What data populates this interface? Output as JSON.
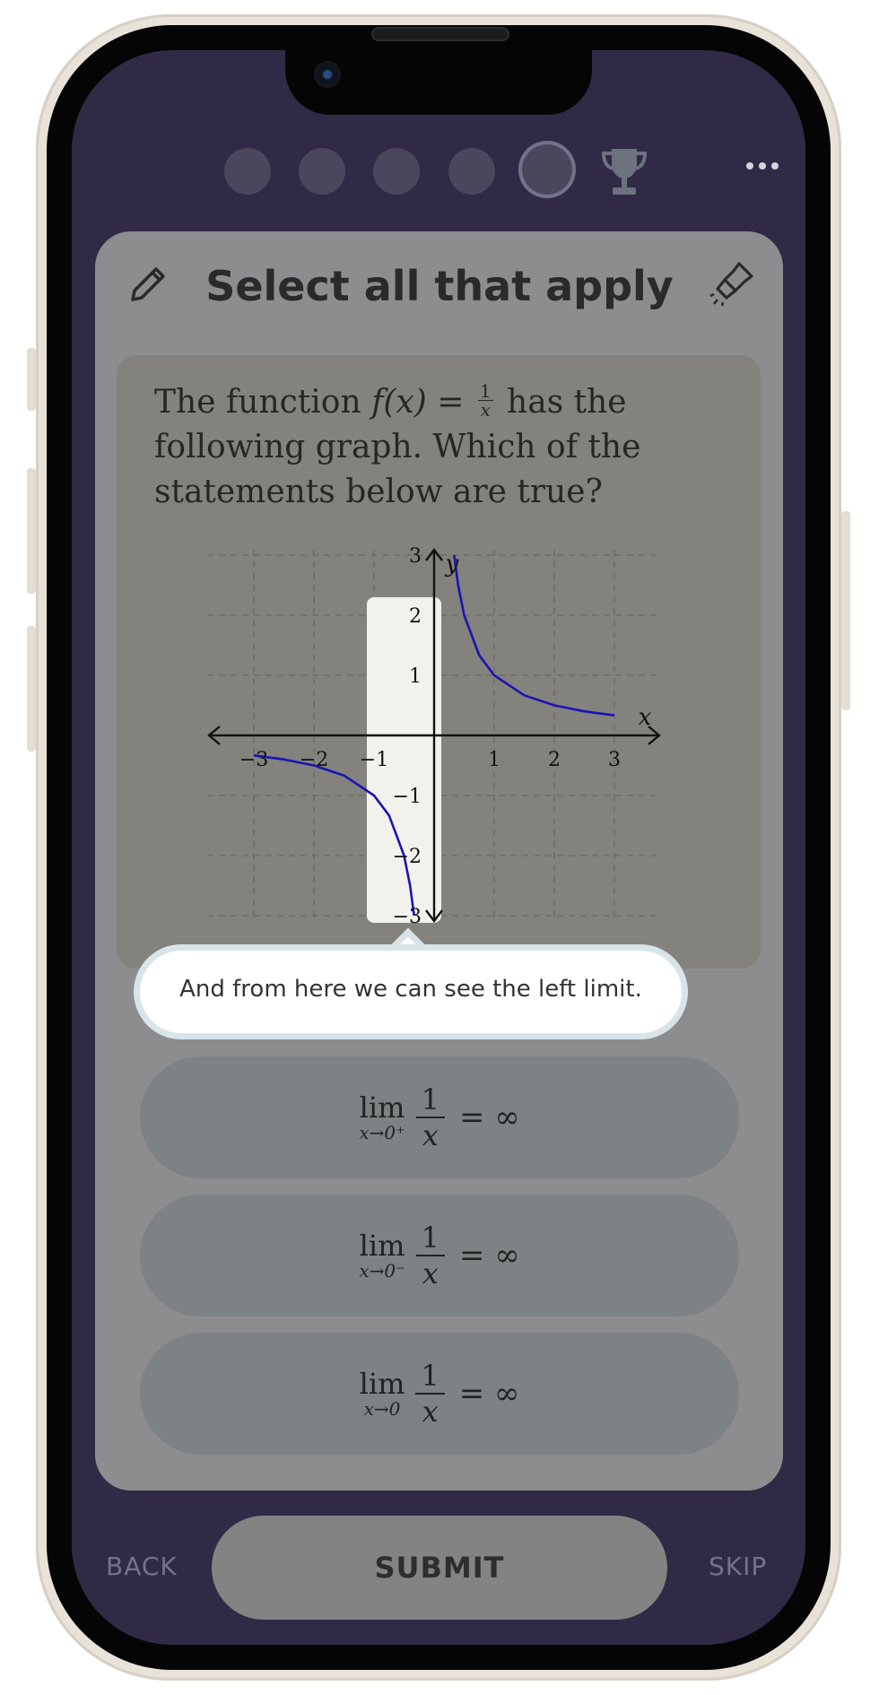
{
  "header": {
    "progress_total": 5,
    "progress_current": 5,
    "trophy_icon": "trophy-icon",
    "more_icon": "more-horizontal-icon"
  },
  "card": {
    "title": "Select all that apply",
    "left_icon": "pencil-icon",
    "right_icon": "flashlight-icon"
  },
  "question": {
    "text_before": "The function ",
    "func": "f(x) = ",
    "frac_num": "1",
    "frac_den": "x",
    "text_after": " has the following graph. Which of the statements below are true?"
  },
  "chart_data": {
    "type": "line",
    "function": "y = 1/x",
    "xlabel": "x",
    "ylabel": "y",
    "xlim": [
      -3,
      3
    ],
    "ylim": [
      -3,
      3
    ],
    "x_ticks": [
      "−3",
      "−2",
      "−1",
      "1",
      "2",
      "3"
    ],
    "y_ticks": [
      "3",
      "2",
      "1",
      "−1",
      "−2",
      "−3"
    ],
    "grid": true,
    "highlight_x_range": [
      -1,
      0
    ],
    "series": [
      {
        "values": [
          [
            -3,
            -0.333
          ],
          [
            -2.5,
            -0.4
          ],
          [
            -2,
            -0.5
          ],
          [
            -1.5,
            -0.667
          ],
          [
            -1,
            -1
          ],
          [
            -0.75,
            -1.333
          ],
          [
            -0.5,
            -2
          ],
          [
            -0.4,
            -2.5
          ],
          [
            -0.333,
            -3
          ]
        ]
      },
      {
        "values": [
          [
            0.333,
            3
          ],
          [
            0.4,
            2.5
          ],
          [
            0.5,
            2
          ],
          [
            0.75,
            1.333
          ],
          [
            1,
            1
          ],
          [
            1.5,
            0.667
          ],
          [
            2,
            0.5
          ],
          [
            2.5,
            0.4
          ],
          [
            3,
            0.333
          ]
        ]
      }
    ],
    "colors": {
      "curve": "#1a14b4",
      "axis": "#111111",
      "grid": "#6a6966",
      "highlight": "#f3f1ec"
    }
  },
  "tooltip": {
    "text": "And from here we can see the left limit."
  },
  "options": [
    {
      "lim": "lim",
      "sub": "x→0⁺",
      "num": "1",
      "den": "x",
      "rhs": "= ∞"
    },
    {
      "lim": "lim",
      "sub": "x→0⁻",
      "num": "1",
      "den": "x",
      "rhs": "= ∞"
    },
    {
      "lim": "lim",
      "sub": "x→0",
      "num": "1",
      "den": "x",
      "rhs": "= ∞"
    }
  ],
  "footer": {
    "back_label": "BACK",
    "submit_label": "SUBMIT",
    "skip_label": "SKIP"
  }
}
